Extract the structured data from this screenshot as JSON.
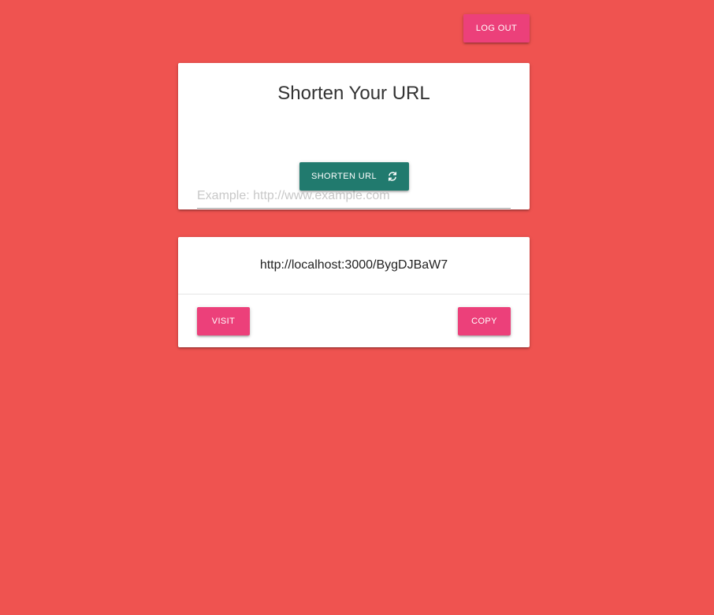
{
  "header": {
    "logout_label": "LOG OUT"
  },
  "shorten_card": {
    "title": "Shorten Your URL",
    "input": {
      "value": "",
      "placeholder": "Example: http://www.example.com"
    },
    "shorten_label": "SHORTEN URL",
    "shorten_icon": "refresh-icon"
  },
  "result_card": {
    "short_url": "http://localhost:3000/BygDJBaW7",
    "visit_label": "VISIT",
    "copy_label": "COPY"
  },
  "colors": {
    "background": "#ef5350",
    "accent_pink": "#ec407a",
    "accent_teal": "#217a6e",
    "card": "#ffffff"
  }
}
